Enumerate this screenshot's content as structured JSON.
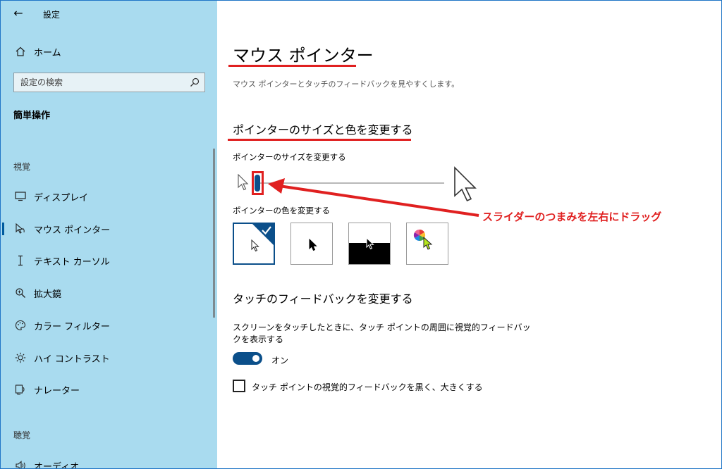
{
  "app": {
    "title": "設定"
  },
  "sidebar": {
    "home_label": "ホーム",
    "search_placeholder": "設定の検索",
    "section_heading": "簡単操作",
    "group_vision": "視覚",
    "group_hearing": "聴覚",
    "items": [
      {
        "label": "ディスプレイ",
        "icon": "monitor-icon"
      },
      {
        "label": "マウス ポインター",
        "icon": "pointer-icon"
      },
      {
        "label": "テキスト カーソル",
        "icon": "text-cursor-icon"
      },
      {
        "label": "拡大鏡",
        "icon": "magnifier-icon"
      },
      {
        "label": "カラー フィルター",
        "icon": "palette-icon"
      },
      {
        "label": "ハイ コントラスト",
        "icon": "sun-icon"
      },
      {
        "label": "ナレーター",
        "icon": "narrator-icon"
      },
      {
        "label": "オーディオ",
        "icon": "speaker-icon"
      }
    ]
  },
  "main": {
    "title": "マウス ポインター",
    "subtitle": "マウス ポインターとタッチのフィードバックを見やすくします。",
    "size_color_heading": "ポインターのサイズと色を変更する",
    "size_label": "ポインターのサイズを変更する",
    "size_value": 0.0,
    "color_label": "ポインターの色を変更する",
    "color_options": [
      "white",
      "black",
      "inverted",
      "custom"
    ],
    "selected_color": "white",
    "touch_heading": "タッチのフィードバックを変更する",
    "touch_desc": "スクリーンをタッチしたときに、タッチ ポイントの周囲に視覚的フィードバックを表示する",
    "toggle_state": "オン",
    "checkbox_label": "タッチ ポイントの視覚的フィードバックを黒く、大きくする"
  },
  "annotation": {
    "text": "スライダーのつまみを左右にドラッグ",
    "color": "#e02020"
  },
  "colors": {
    "sidebar_bg": "#a9dbef",
    "accent": "#0b4f8a"
  }
}
